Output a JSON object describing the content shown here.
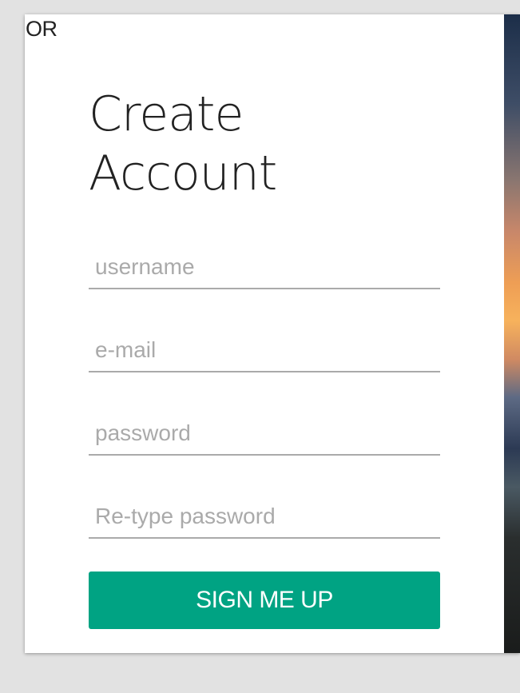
{
  "or_label": "OR",
  "form": {
    "title_line1": "Create",
    "title_line2": "Account",
    "fields": {
      "username_placeholder": "username",
      "email_placeholder": "e-mail",
      "password_placeholder": "password",
      "retype_placeholder": "Re-type password"
    },
    "submit_label": "SIGN ME UP"
  },
  "colors": {
    "accent": "#00a383",
    "background": "#e2e2e2",
    "card": "#ffffff"
  }
}
